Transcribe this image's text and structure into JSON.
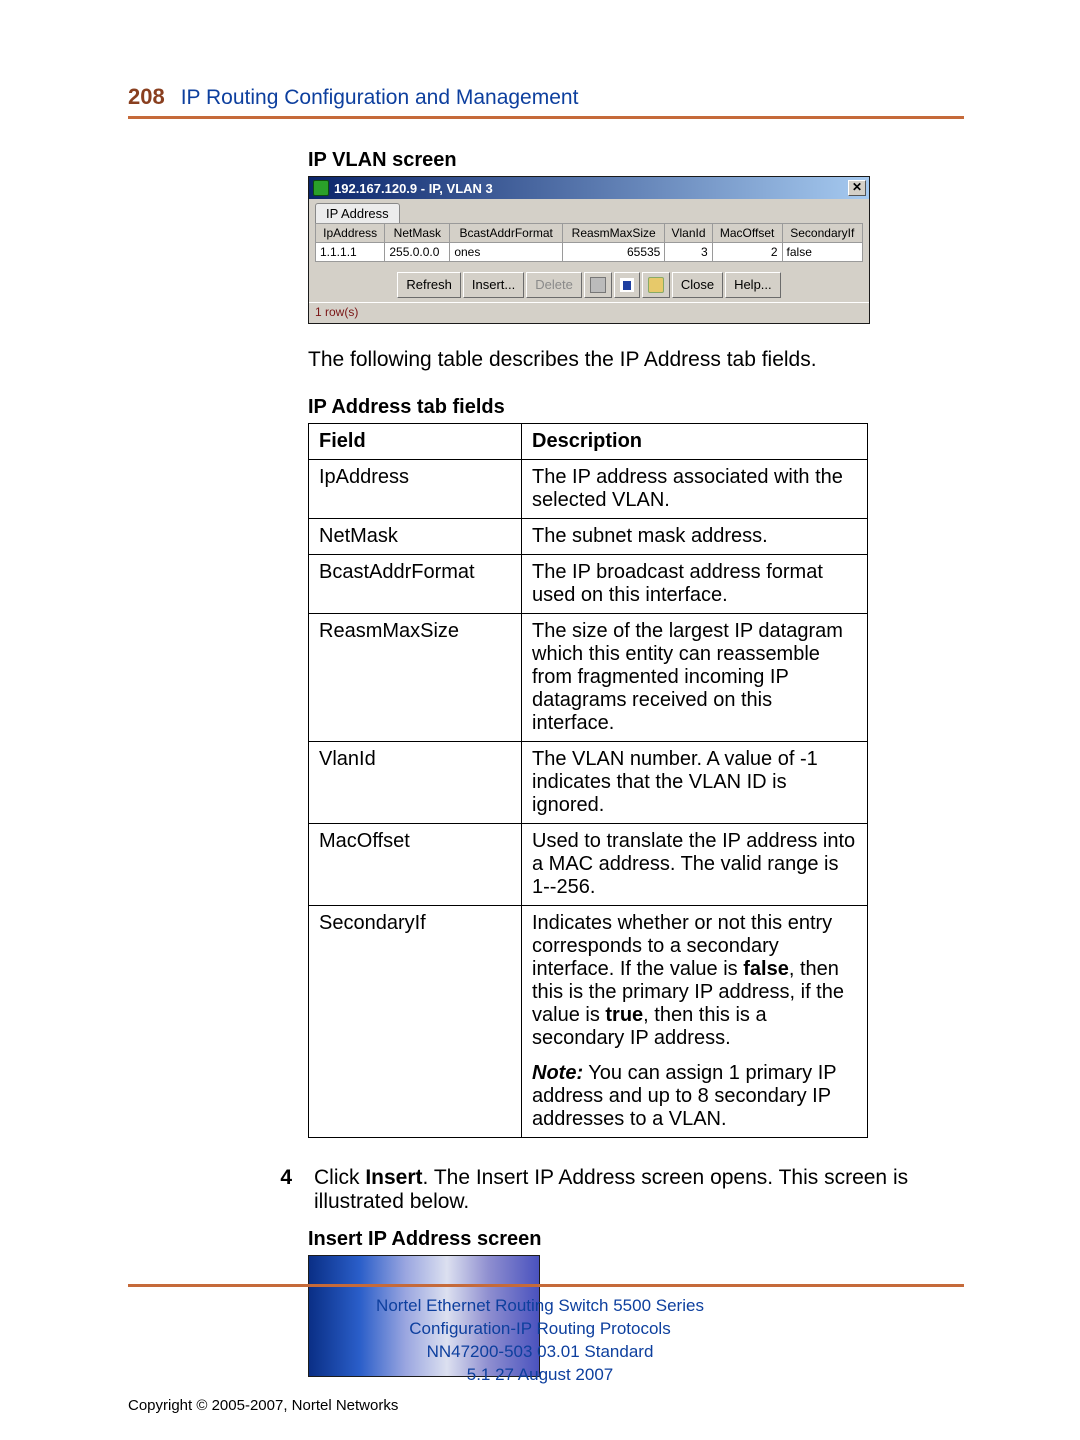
{
  "header": {
    "page_number": "208",
    "section_title": "IP Routing Configuration and Management"
  },
  "caption_ipvlan": "IP VLAN screen",
  "dialog": {
    "title": "192.167.120.9 - IP, VLAN 3",
    "tab_label": "IP Address",
    "columns": [
      "IpAddress",
      "NetMask",
      "BcastAddrFormat",
      "ReasmMaxSize",
      "VlanId",
      "MacOffset",
      "SecondaryIf"
    ],
    "row": {
      "IpAddress": "1.1.1.1",
      "NetMask": "255.0.0.0",
      "BcastAddrFormat": "ones",
      "ReasmMaxSize": "65535",
      "VlanId": "3",
      "MacOffset": "2",
      "SecondaryIf": "false"
    },
    "buttons": {
      "refresh": "Refresh",
      "insert": "Insert...",
      "delete": "Delete",
      "close": "Close",
      "help": "Help..."
    },
    "status": "1 row(s)"
  },
  "para_after_dialog": "The following table describes the IP Address tab fields.",
  "caption_fields": "IP Address tab fields",
  "fields_table": {
    "head_field": "Field",
    "head_desc": "Description",
    "rows": [
      {
        "field": "IpAddress",
        "desc": "The IP address associated with the selected VLAN."
      },
      {
        "field": "NetMask",
        "desc": "The subnet mask address."
      },
      {
        "field": "BcastAddrFormat",
        "desc": "The IP broadcast address format used on this interface."
      },
      {
        "field": "ReasmMaxSize",
        "desc": "The size of the largest IP datagram which this entity can reassemble from fragmented incoming IP datagrams received on this interface."
      },
      {
        "field": "VlanId",
        "desc": "The VLAN number. A value of -1 indicates that the VLAN ID is ignored."
      },
      {
        "field": "MacOffset",
        "desc": "Used to translate the IP address into a MAC address. The valid range is 1--256."
      }
    ],
    "secondary": {
      "field": "SecondaryIf",
      "desc_pre": "Indicates whether or not this entry corresponds to a secondary interface. If the value is ",
      "bold_false": "false",
      "desc_mid": ", then this is the primary IP address, if the value is ",
      "bold_true": "true",
      "desc_post": ", then this is a secondary IP address.",
      "note_label": "Note:",
      "note_text": " You can assign 1 primary IP address and up to 8 secondary IP addresses to a VLAN."
    }
  },
  "step4": {
    "number": "4",
    "pre": "Click ",
    "bold": "Insert",
    "post": ". The Insert IP Address screen opens. This screen is illustrated below."
  },
  "caption_insert": "Insert IP Address screen",
  "footer": {
    "line1": "Nortel Ethernet Routing Switch 5500 Series",
    "line2": "Configuration-IP Routing Protocols",
    "line3": "NN47200-503   03.01   Standard",
    "line4": "5.1   27 August 2007",
    "copyright": "Copyright © 2005-2007, Nortel Networks"
  }
}
